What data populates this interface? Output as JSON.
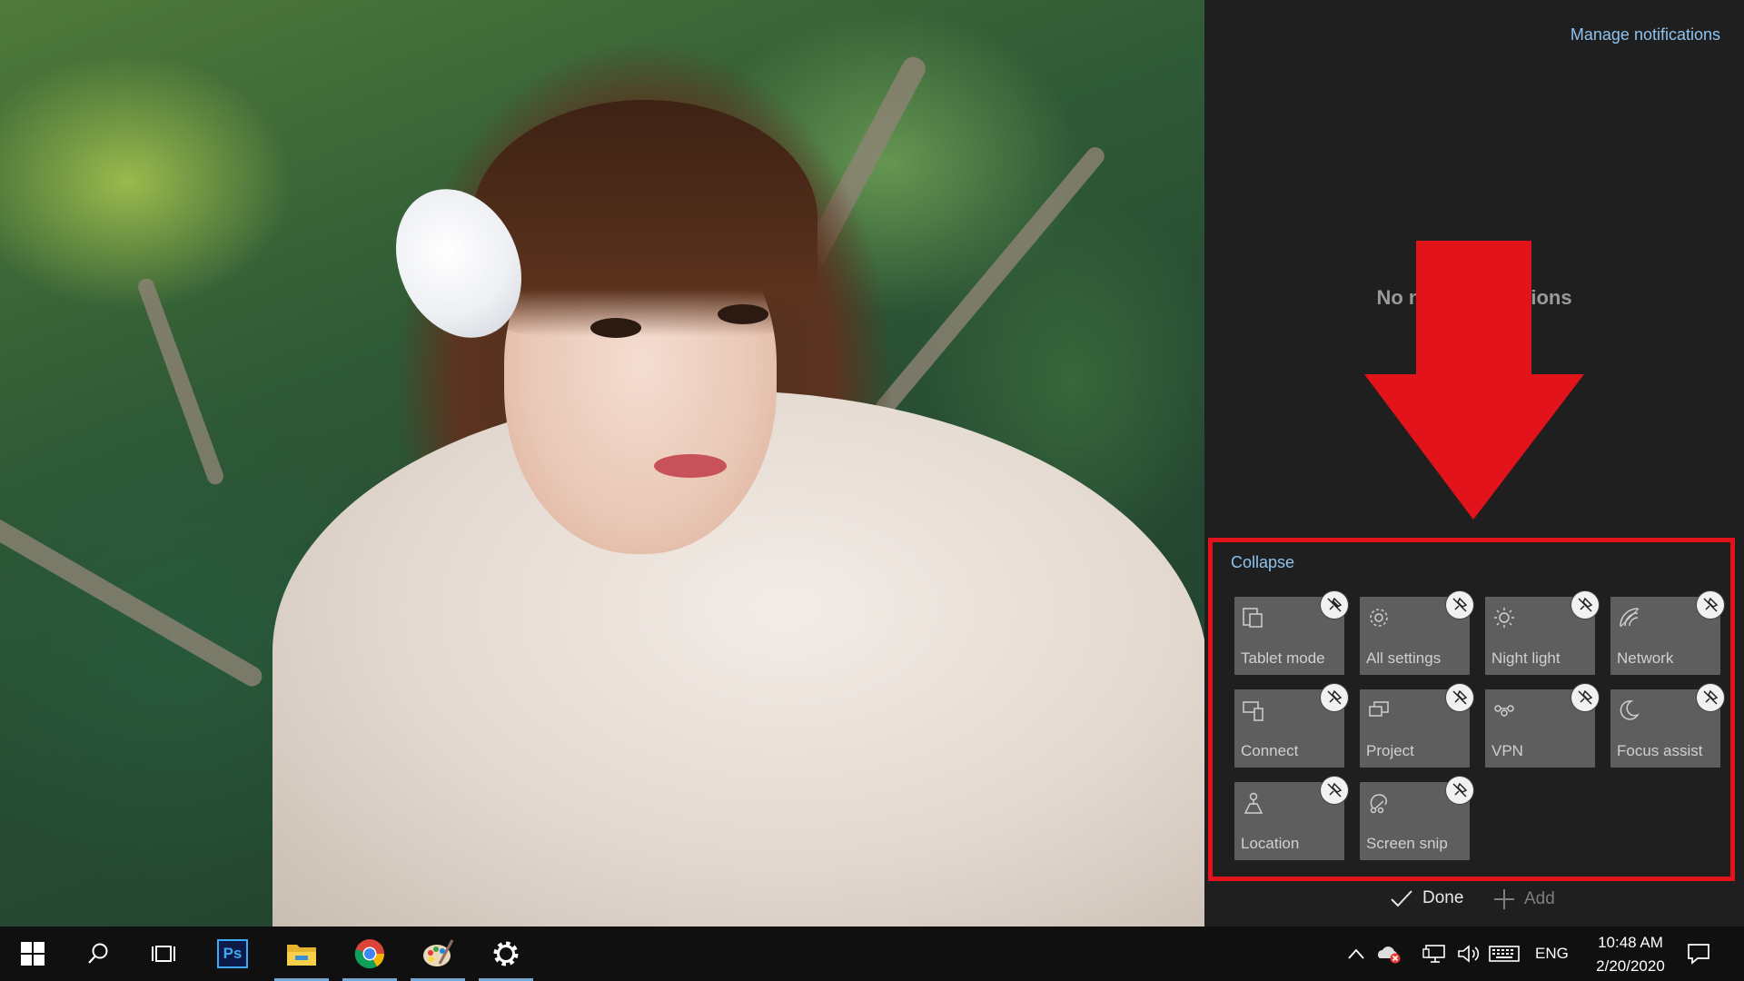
{
  "action_center": {
    "manage_notifications": "Manage notifications",
    "no_notifications": "No new notifications",
    "collapse": "Collapse",
    "tiles": [
      {
        "label": "Tablet mode",
        "icon": "tablet-mode-icon"
      },
      {
        "label": "All settings",
        "icon": "gear-icon"
      },
      {
        "label": "Night light",
        "icon": "night-light-icon"
      },
      {
        "label": "Network",
        "icon": "network-icon"
      },
      {
        "label": "Connect",
        "icon": "connect-icon"
      },
      {
        "label": "Project",
        "icon": "project-icon"
      },
      {
        "label": "VPN",
        "icon": "vpn-icon"
      },
      {
        "label": "Focus assist",
        "icon": "moon-icon"
      },
      {
        "label": "Location",
        "icon": "location-icon"
      },
      {
        "label": "Screen snip",
        "icon": "screen-snip-icon"
      }
    ],
    "done_label": "Done",
    "add_label": "Add"
  },
  "annotation": {
    "arrow_color": "#e3131b"
  },
  "taskbar": {
    "apps": [
      {
        "name": "start",
        "icon": "windows-logo-icon"
      },
      {
        "name": "search",
        "icon": "search-icon"
      },
      {
        "name": "task-view",
        "icon": "task-view-icon"
      },
      {
        "name": "photoshop",
        "icon": "photoshop-icon",
        "text": "Ps"
      },
      {
        "name": "file-explorer",
        "icon": "folder-icon"
      },
      {
        "name": "chrome",
        "icon": "chrome-icon"
      },
      {
        "name": "paint",
        "icon": "paint-palette-icon"
      },
      {
        "name": "settings",
        "icon": "gear-icon"
      }
    ],
    "language": "ENG",
    "time": "10:48 AM",
    "date": "2/20/2020"
  },
  "colors": {
    "panel_bg": "#1f1f1f",
    "tile_bg": "#5e5e5e",
    "link": "#8fc3ee",
    "highlight_box": "#e3131b",
    "taskbar_bg": "#101010"
  }
}
